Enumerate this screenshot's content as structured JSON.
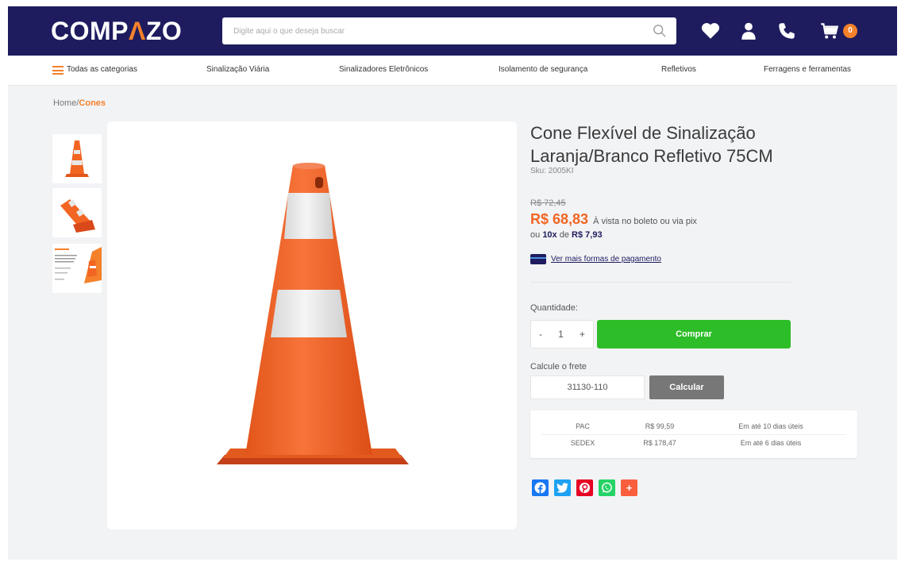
{
  "header": {
    "logo_left": "COMP",
    "logo_accent": "Λ",
    "logo_right": "ZO",
    "search_placeholder": "Digite aqui o que deseja buscar",
    "cart_count": "0"
  },
  "categories": [
    {
      "label": "Todas as categorias"
    },
    {
      "label": "Sinalização Viária"
    },
    {
      "label": "Sinalizadores Eletrônicos"
    },
    {
      "label": "Isolamento de segurança"
    },
    {
      "label": "Refletivos"
    },
    {
      "label": "Ferragens e ferramentas"
    }
  ],
  "breadcrumb": {
    "home": "Home",
    "separator": "/",
    "current": "Cones"
  },
  "product": {
    "title": "Cone Flexível de Sinalização Laranja/Branco Refletivo 75CM",
    "sku": "Sku: 2005KI",
    "old_price": "R$ 72,45",
    "price": "R$ 68,83",
    "price_note": "À vista no boleto ou via pix",
    "installments_prefix": "ou",
    "installments_count": "10x",
    "installments_mid": "de",
    "installments_value": "R$ 7,93",
    "payment_link": "Ver mais formas de pagamento"
  },
  "purchase": {
    "quantity_label": "Quantidade:",
    "minus": "-",
    "quantity": "1",
    "plus": "+",
    "buy_label": "Comprar"
  },
  "shipping": {
    "label": "Calcule o frete",
    "cep_value": "31130-110",
    "calc_label": "Calcular",
    "rows": [
      {
        "service": "PAC",
        "price": "R$ 99,59",
        "time": "Em até 10 dias úteis"
      },
      {
        "service": "SEDEX",
        "price": "R$ 178,47",
        "time": "Em até 6 dias úteis"
      }
    ]
  },
  "share": {
    "plus": "+"
  },
  "colors": {
    "navy": "#1e1c5e",
    "orange": "#f5812a",
    "price": "#f26522",
    "buy_green": "#2dbd28",
    "facebook": "#1877f2",
    "twitter": "#1da1f2",
    "pinterest": "#e60023",
    "whatsapp": "#25d366",
    "addthis": "#f95f3d"
  }
}
